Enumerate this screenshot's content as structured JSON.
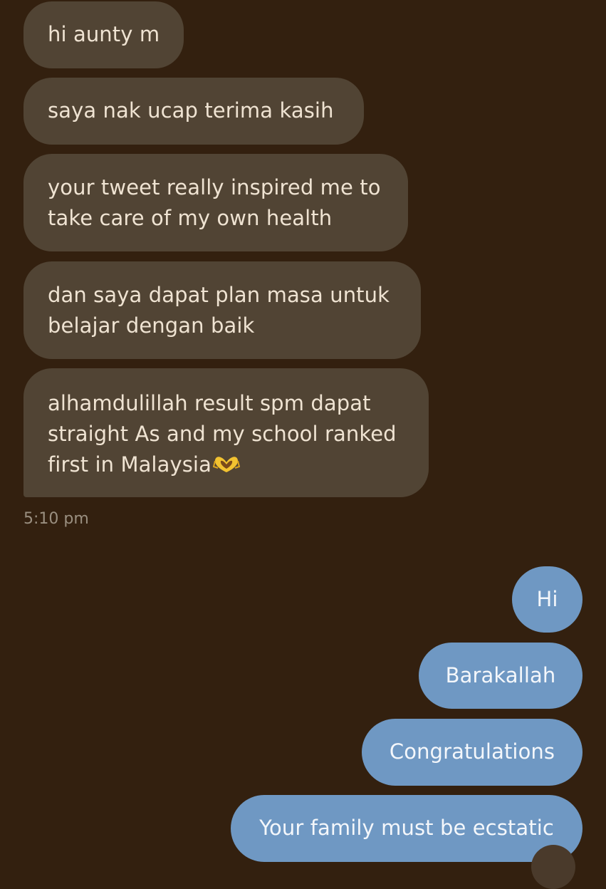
{
  "conversation": {
    "incoming": [
      {
        "lines": [
          "hi aunty m"
        ]
      },
      {
        "lines": [
          "saya nak ucap terima kasih"
        ]
      },
      {
        "lines": [
          "your tweet really inspired me to",
          "take care of my own health"
        ]
      },
      {
        "lines": [
          "dan saya dapat plan masa untuk",
          "belajar dengan baik"
        ]
      },
      {
        "lines": [
          "alhamdulillah result spm dapat",
          "straight As and my school ranked",
          "first in Malaysia"
        ],
        "emoji": "heart-hands-icon"
      }
    ],
    "timestamp": "5:10 pm",
    "outgoing": [
      {
        "text": "Hi"
      },
      {
        "text": "Barakallah"
      },
      {
        "text": "Congratulations"
      },
      {
        "text": "Your family must be ecstatic"
      }
    ]
  },
  "colors": {
    "background": "#33200f",
    "incoming_bubble": "#514434",
    "incoming_text": "#efe3d2",
    "outgoing_bubble": "#6f98c3",
    "outgoing_text": "#f4f7fb",
    "timestamp_text": "#9a8f80",
    "emoji": "#f2c230"
  }
}
